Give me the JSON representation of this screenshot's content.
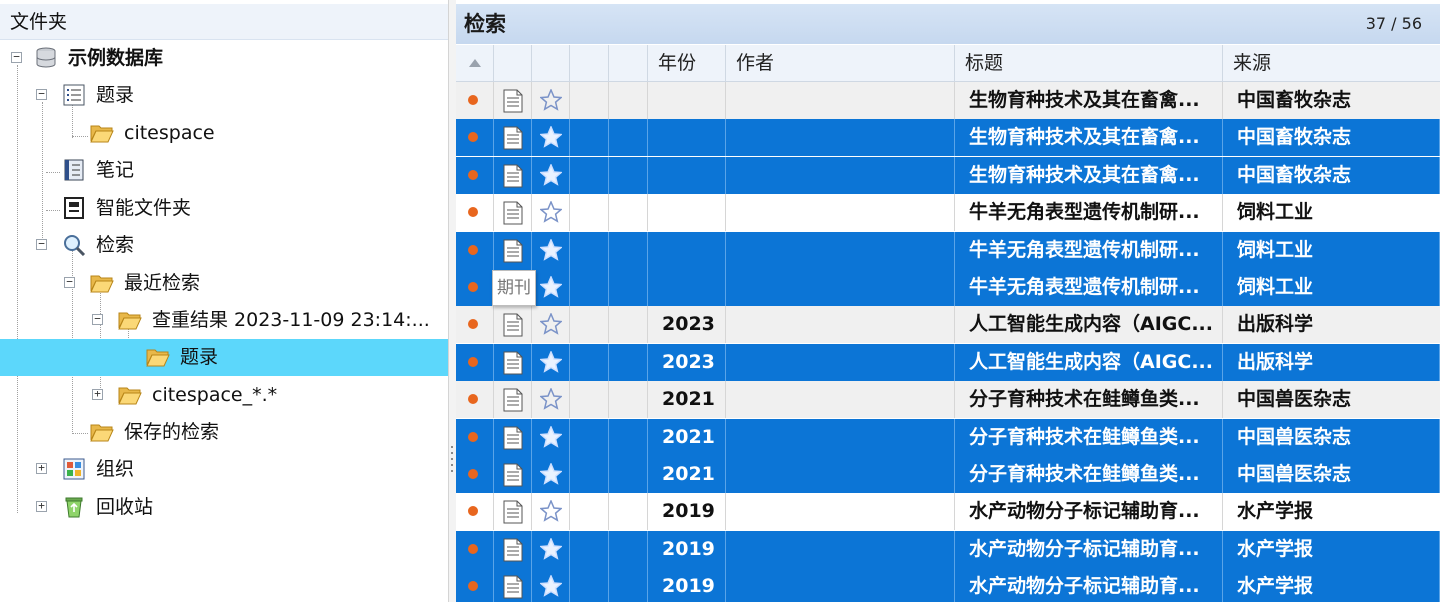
{
  "left_panel": {
    "title": "文件夹",
    "tree": {
      "db": "示例数据库",
      "bibliography": "题录",
      "citespace": "citespace",
      "notes": "笔记",
      "smart_folder": "智能文件夹",
      "search": "检索",
      "recent_search": "最近检索",
      "dup_result": "查重结果 2023-11-09 23:14:...",
      "dup_bibliography": "题录",
      "citespace_wild": "citespace_*.*",
      "saved_search": "保存的检索",
      "organization": "组织",
      "recycle_bin": "回收站"
    }
  },
  "right_panel": {
    "title": "检索",
    "count": "37 / 56",
    "columns": {
      "year": "年份",
      "author": "作者",
      "title": "标题",
      "source": "来源"
    },
    "tooltip": "期刊",
    "rows": [
      {
        "year": "",
        "title": "生物育种技术及其在畜禽...",
        "source": "中国畜牧杂志",
        "state": "alt"
      },
      {
        "year": "",
        "title": "生物育种技术及其在畜禽...",
        "source": "中国畜牧杂志",
        "state": "sel"
      },
      {
        "year": "",
        "title": "生物育种技术及其在畜禽...",
        "source": "中国畜牧杂志",
        "state": "sel"
      },
      {
        "year": "",
        "title": "牛羊无角表型遗传机制研...",
        "source": "饲料工业",
        "state": "plain"
      },
      {
        "year": "",
        "title": "牛羊无角表型遗传机制研...",
        "source": "饲料工业",
        "state": "sel"
      },
      {
        "year": "",
        "title": "牛羊无角表型遗传机制研...",
        "source": "饲料工业",
        "state": "sel"
      },
      {
        "year": "2023",
        "title": "人工智能生成内容（AIGC...",
        "source": "出版科学",
        "state": "alt"
      },
      {
        "year": "2023",
        "title": "人工智能生成内容（AIGC...",
        "source": "出版科学",
        "state": "sel"
      },
      {
        "year": "2021",
        "title": "分子育种技术在鲑鳟鱼类...",
        "source": "中国兽医杂志",
        "state": "alt"
      },
      {
        "year": "2021",
        "title": "分子育种技术在鲑鳟鱼类...",
        "source": "中国兽医杂志",
        "state": "sel"
      },
      {
        "year": "2021",
        "title": "分子育种技术在鲑鳟鱼类...",
        "source": "中国兽医杂志",
        "state": "sel"
      },
      {
        "year": "2019",
        "title": "水产动物分子标记辅助育...",
        "source": "水产学报",
        "state": "plain"
      },
      {
        "year": "2019",
        "title": "水产动物分子标记辅助育...",
        "source": "水产学报",
        "state": "sel"
      },
      {
        "year": "2019",
        "title": "水产动物分子标记辅助育...",
        "source": "水产学报",
        "state": "sel"
      }
    ]
  },
  "colors": {
    "selected_row": "#0c75d6",
    "selected_tree": "#5cd7fb",
    "dot": "#e8661e"
  }
}
